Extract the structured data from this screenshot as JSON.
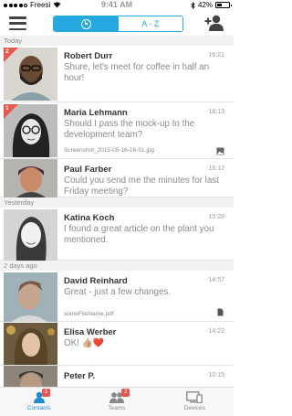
{
  "status_bar": {
    "carrier": "Freesi",
    "time": "9:41 AM",
    "battery": "42%",
    "battery_level": 0.42
  },
  "nav": {
    "menu_icon": "hamburger-icon",
    "segment_recent_icon": "clock-icon",
    "segment_az_label": "A - Z",
    "add_contact_icon": "add-contact-icon"
  },
  "sections": {
    "today": "Today",
    "yesterday": "Yesterday",
    "two_days_ago": "2 days ago"
  },
  "messages": [
    {
      "name": "Robert Durr",
      "time": "16:21",
      "message": "Shure, let's meet for coffee in half an hour!",
      "badge": "2"
    },
    {
      "name": "Maria Lehmann",
      "time": "16:13",
      "message": "Should I pass the mock-up to the development team?",
      "attachment": "Screenshot_2015-05-16-16-51.jpg",
      "badge": "1"
    },
    {
      "name": "Paul Farber",
      "time": "16:12",
      "message": "Could you send me the minutes for last Friday meeting?"
    },
    {
      "name": "Katina Koch",
      "time": "15:28",
      "message": "I found a great article on the plant you mentioned."
    },
    {
      "name": "David Reinhard",
      "time": "14:57",
      "message": "Great - just a few changes.",
      "attachment": "someFileName.pdf"
    },
    {
      "name": "Elisa Werber",
      "time": "14:22",
      "message": "OK! 👍🏼❤️"
    },
    {
      "name": "Peter P.",
      "time": "10:15",
      "message": ""
    }
  ],
  "tab_bar": {
    "contacts": {
      "label": "Contacts",
      "badge": "3"
    },
    "teams": {
      "label": "Teams",
      "badge": "2"
    },
    "devices": {
      "label": "Devices"
    }
  },
  "colors": {
    "accent": "#26a9e0",
    "badge": "#e8574f"
  }
}
